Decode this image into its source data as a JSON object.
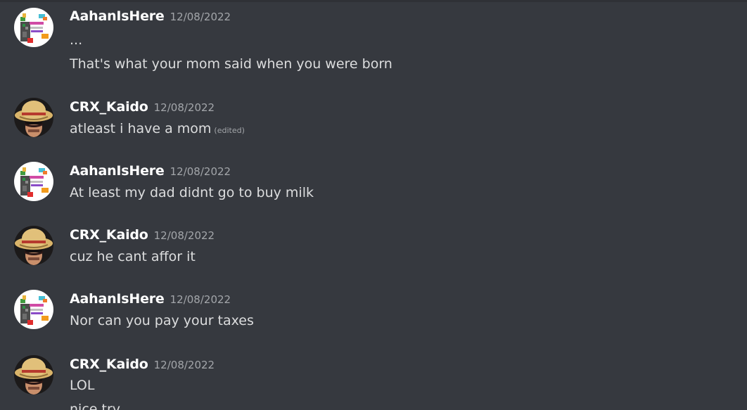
{
  "messages": [
    {
      "author": "AahanIsHere",
      "timestamp": "12/08/2022",
      "avatar": "killer-survivor-avatar",
      "lines": [
        "...",
        "That's what your mom said when you were born"
      ]
    },
    {
      "author": "CRX_Kaido",
      "timestamp": "12/08/2022",
      "avatar": "straw-hat-avatar",
      "lines": [
        "atleast i have a mom"
      ],
      "edited": "(edited)"
    },
    {
      "author": "AahanIsHere",
      "timestamp": "12/08/2022",
      "avatar": "killer-survivor-avatar",
      "lines": [
        "At least my  dad didnt go to buy milk"
      ]
    },
    {
      "author": "CRX_Kaido",
      "timestamp": "12/08/2022",
      "avatar": "straw-hat-avatar",
      "lines": [
        "cuz he cant affor it"
      ]
    },
    {
      "author": "AahanIsHere",
      "timestamp": "12/08/2022",
      "avatar": "killer-survivor-avatar",
      "lines": [
        "Nor can you pay your taxes"
      ]
    },
    {
      "author": "CRX_Kaido",
      "timestamp": "12/08/2022",
      "avatar": "straw-hat-avatar",
      "lines": [
        "LOL",
        "nice try"
      ]
    }
  ],
  "colors": {
    "background": "#36393f",
    "username": "#ffffff",
    "message_text": "#dcddde",
    "timestamp": "#a3a6aa"
  }
}
